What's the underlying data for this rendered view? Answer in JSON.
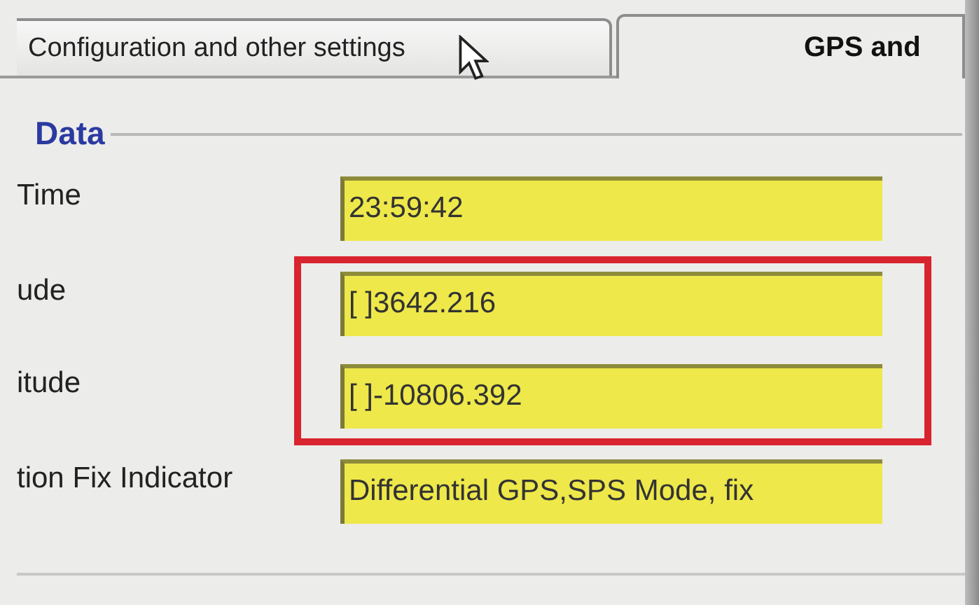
{
  "tabs": [
    {
      "label": "Configuration and other settings",
      "selected": false
    },
    {
      "label": "GPS and",
      "selected": true
    }
  ],
  "group": {
    "title": "Data",
    "fields": [
      {
        "label": "Time",
        "value": "23:59:42",
        "highlighted": false
      },
      {
        "label": "ude",
        "value": "[ ]3642.216",
        "highlighted": true
      },
      {
        "label": "itude",
        "value": "[ ]-10806.392",
        "highlighted": true
      },
      {
        "label": "tion Fix Indicator",
        "value": "Differential GPS,SPS Mode, fix",
        "highlighted": false
      }
    ]
  }
}
